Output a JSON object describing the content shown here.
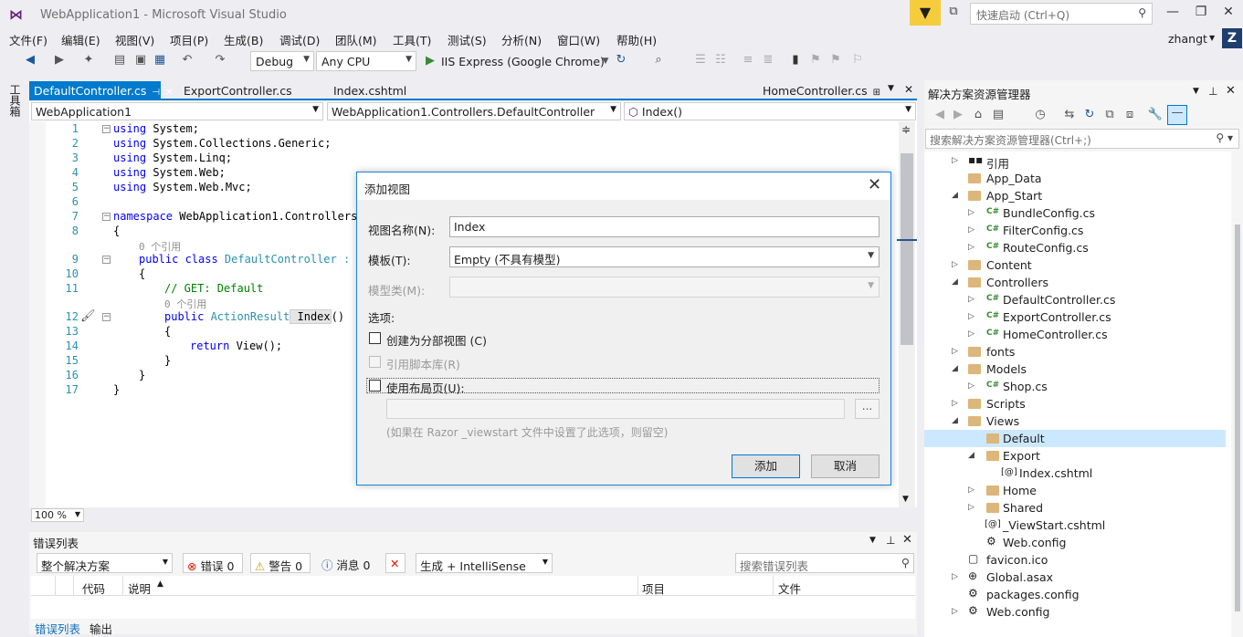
{
  "window": {
    "title": "WebApplication1 - Microsoft Visual Studio",
    "quick_launch_placeholder": "快速启动 (Ctrl+Q)",
    "user": "zhangt",
    "avatar_letter": "Z"
  },
  "menu": [
    "文件(F)",
    "编辑(E)",
    "视图(V)",
    "项目(P)",
    "生成(B)",
    "调试(D)",
    "团队(M)",
    "工具(T)",
    "测试(S)",
    "分析(N)",
    "窗口(W)",
    "帮助(H)"
  ],
  "toolbar": {
    "config": "Debug",
    "platform": "Any CPU",
    "run_target": "IIS Express (Google Chrome)"
  },
  "toolbox_label": "工具箱",
  "tabs": {
    "active": "DefaultController.cs",
    "t2": "ExportController.cs",
    "t3": "Index.cshtml",
    "right": "HomeController.cs"
  },
  "navbar": {
    "project": "WebApplication1",
    "class": "WebApplication1.Controllers.DefaultController",
    "member": "Index()"
  },
  "code": {
    "lines": [
      "1",
      "2",
      "3",
      "4",
      "5",
      "6",
      "7",
      "8",
      "",
      "9",
      "10",
      "11",
      "",
      "12",
      "13",
      "14",
      "15",
      "16",
      "17"
    ],
    "l1_kw": "using",
    "l1_rest": " System;",
    "l2_kw": "using",
    "l2_rest": " System.Collections.Generic;",
    "l3_kw": "using",
    "l3_rest": " System.Linq;",
    "l4_kw": "using",
    "l4_rest": " System.Web;",
    "l5_kw": "using",
    "l5_rest": " System.Web.Mvc;",
    "l7_kw": "namespace",
    "l7_rest": " WebApplication1.Controllers",
    "brace_open": "{",
    "brace_close": "}",
    "ref0a": "0 个引用",
    "l9_kw": "public class",
    "l9_type": " DefaultController : C",
    "l11_comment": "// GET: Default",
    "ref0b": "0 个引用",
    "l12_kw": "public",
    "l12_type": " ActionResult",
    "l12_name": " Index",
    "l12_paren": "()",
    "l14_kw": "return",
    "l14_rest": " View();"
  },
  "zoom": "100 %",
  "error_list": {
    "title": "错误列表",
    "scope": "整个解决方案",
    "errors": "错误 0",
    "warnings": "警告 0",
    "messages": "消息 0",
    "build_filter": "生成 + IntelliSense",
    "search_placeholder": "搜索错误列表",
    "col_code": "代码",
    "col_desc": "说明",
    "col_project": "项目",
    "col_file": "文件"
  },
  "bottom_tabs": {
    "errors": "错误列表",
    "output": "输出"
  },
  "solution": {
    "title": "解决方案资源管理器",
    "search_placeholder": "搜索解决方案资源管理器(Ctrl+;)",
    "nodes": [
      {
        "label": "引用"
      },
      {
        "label": "App_Data"
      },
      {
        "label": "App_Start"
      },
      {
        "label": "BundleConfig.cs"
      },
      {
        "label": "FilterConfig.cs"
      },
      {
        "label": "RouteConfig.cs"
      },
      {
        "label": "Content"
      },
      {
        "label": "Controllers"
      },
      {
        "label": "DefaultController.cs"
      },
      {
        "label": "ExportController.cs"
      },
      {
        "label": "HomeController.cs"
      },
      {
        "label": "fonts"
      },
      {
        "label": "Models"
      },
      {
        "label": "Shop.cs"
      },
      {
        "label": "Scripts"
      },
      {
        "label": "Views"
      },
      {
        "label": "Default"
      },
      {
        "label": "Export"
      },
      {
        "label": "Index.cshtml"
      },
      {
        "label": "Home"
      },
      {
        "label": "Shared"
      },
      {
        "label": "_ViewStart.cshtml"
      },
      {
        "label": "Web.config"
      },
      {
        "label": "favicon.ico"
      },
      {
        "label": "Global.asax"
      },
      {
        "label": "packages.config"
      },
      {
        "label": "Web.config"
      }
    ]
  },
  "dialog": {
    "title": "添加视图",
    "view_name_label": "视图名称(N):",
    "view_name_value": "Index",
    "template_label": "模板(T):",
    "template_value": "Empty (不具有模型)",
    "model_label": "模型类(M):",
    "options_label": "选项:",
    "partial_label": "创建为分部视图 (C)",
    "scripts_label": "引用脚本库(R)",
    "layout_label": "使用布局页(U):",
    "browse_label": "...",
    "hint": "(如果在 Razor _viewstart 文件中设置了此选项，则留空)",
    "add_button": "添加",
    "cancel_button": "取消"
  }
}
